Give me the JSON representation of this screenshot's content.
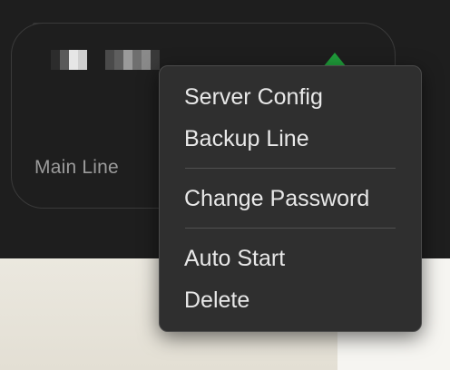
{
  "card": {
    "label": "Main Line",
    "status_color": "#1f9d3a",
    "status_icon": "triangle-up-icon"
  },
  "context_menu": {
    "groups": [
      [
        "Server Config",
        "Backup Line"
      ],
      [
        "Change Password"
      ],
      [
        "Auto Start",
        "Delete"
      ]
    ]
  }
}
